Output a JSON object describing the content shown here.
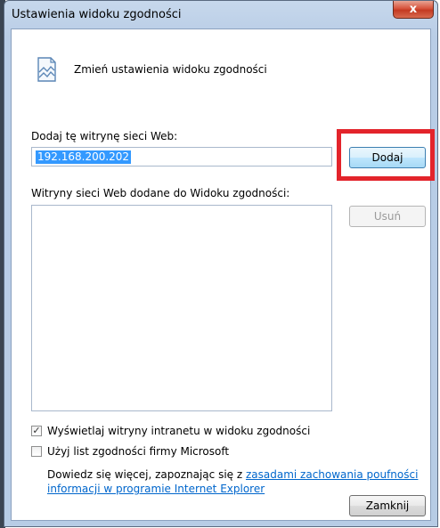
{
  "window": {
    "title": "Ustawienia widoku zgodności",
    "close_glyph": "x"
  },
  "header": {
    "icon": "compatibility-view-icon",
    "text": "Zmień ustawienia widoku zgodności"
  },
  "add_section": {
    "label": "Dodaj tę witrynę sieci Web:",
    "input_value": "192.168.200.202",
    "add_button": "Dodaj"
  },
  "list_section": {
    "label": "Witryny sieci Web dodane do Widoku zgodności:",
    "items": [],
    "remove_button": "Usuń"
  },
  "options": {
    "intranet": {
      "label": "Wyświetlaj witryny intranetu w widoku zgodności",
      "checked": true
    },
    "microsoft_lists": {
      "label": "Użyj list zgodności firmy Microsoft",
      "checked": false
    }
  },
  "info": {
    "prefix": "Dowiedz się więcej, zapoznając się z ",
    "link": "zasadami zachowania poufności informacji w programie Internet Explorer"
  },
  "close_button": "Zamknij",
  "colors": {
    "highlight": "#e3242b",
    "link": "#0066cc",
    "selection": "#3399ff"
  }
}
